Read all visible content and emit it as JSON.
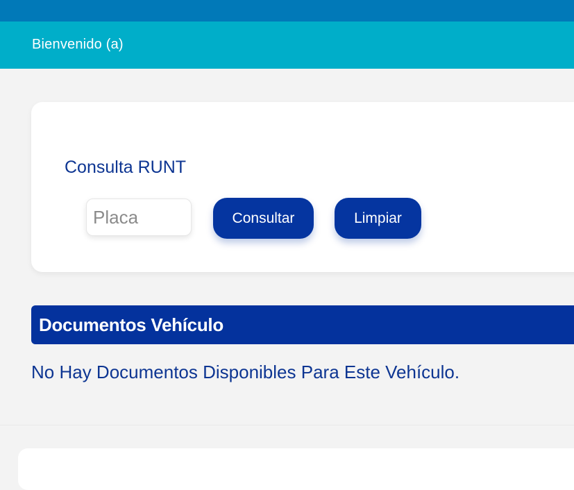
{
  "header": {
    "welcome_text": "Bienvenido (a)",
    "top_bar_color": "#0179b8",
    "welcome_bar_color": "#00aec9"
  },
  "query": {
    "title": "Consulta RUNT",
    "plate_placeholder": "Placa",
    "plate_value": "",
    "consult_label": "Consultar",
    "clear_label": "Limpiar"
  },
  "documents": {
    "header_title": "Documentos Vehículo",
    "empty_message": "No Hay Documentos Disponibles Para Este Vehículo."
  },
  "colors": {
    "primary": "#04329d",
    "text_blue": "#0d3592",
    "background": "#f3f3f3"
  }
}
